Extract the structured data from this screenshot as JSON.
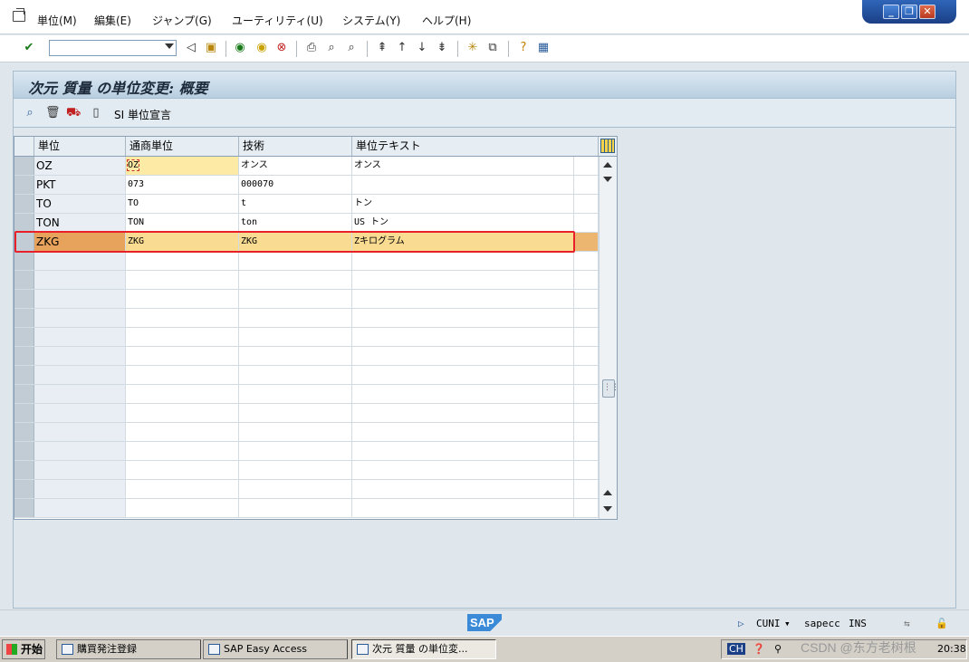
{
  "menu": {
    "items": [
      "単位(M)",
      "編集(E)",
      "ジャンプ(G)",
      "ユーティリティ(U)",
      "システム(Y)",
      "ヘルプ(H)"
    ]
  },
  "window_controls": {
    "minimize": "_",
    "restore": "❐",
    "close": "✕"
  },
  "toolbar": {
    "command_value": "",
    "icons": [
      "check-icon",
      "back-icon",
      "save-icon",
      "back-green-icon",
      "exit-icon",
      "cancel-icon",
      "print-icon",
      "find-icon",
      "find-next-icon",
      "first-page-icon",
      "prev-page-icon",
      "next-page-icon",
      "last-page-icon",
      "new-session-icon",
      "shortcut-icon",
      "help-icon",
      "layout-icon"
    ]
  },
  "screen": {
    "title": "次元 質量 の単位変更: 概要"
  },
  "app_toolbar": {
    "si_label": "SI 単位宣言"
  },
  "table": {
    "columns": [
      "単位",
      "通商単位",
      "技術",
      "単位テキスト"
    ],
    "rows": [
      [
        "OZ",
        "OZ",
        "オンス",
        "オンス"
      ],
      [
        "PKT",
        "073",
        "000070",
        ""
      ],
      [
        "TO",
        "TO",
        "t",
        "トン"
      ],
      [
        "TON",
        "TON",
        "ton",
        "US トン"
      ],
      [
        "ZKG",
        "ZKG",
        "ZKG",
        "Zキログラム"
      ]
    ],
    "highlighted_row": 4,
    "empty_rows": 14
  },
  "status": {
    "transaction": "CUNI",
    "server": "sapecc",
    "mode": "INS"
  },
  "taskbar": {
    "start": "开始",
    "tasks": [
      "購買発注登録",
      "SAP Easy Access",
      "次元 質量 の単位変..."
    ],
    "lang": "CH",
    "time": "20:38",
    "watermark": "CSDN @东方老树根"
  },
  "colors": {
    "highlight_row": "#f9dc91",
    "highlight_border": "#e8202a",
    "title_bar": "#b8cfe1"
  }
}
